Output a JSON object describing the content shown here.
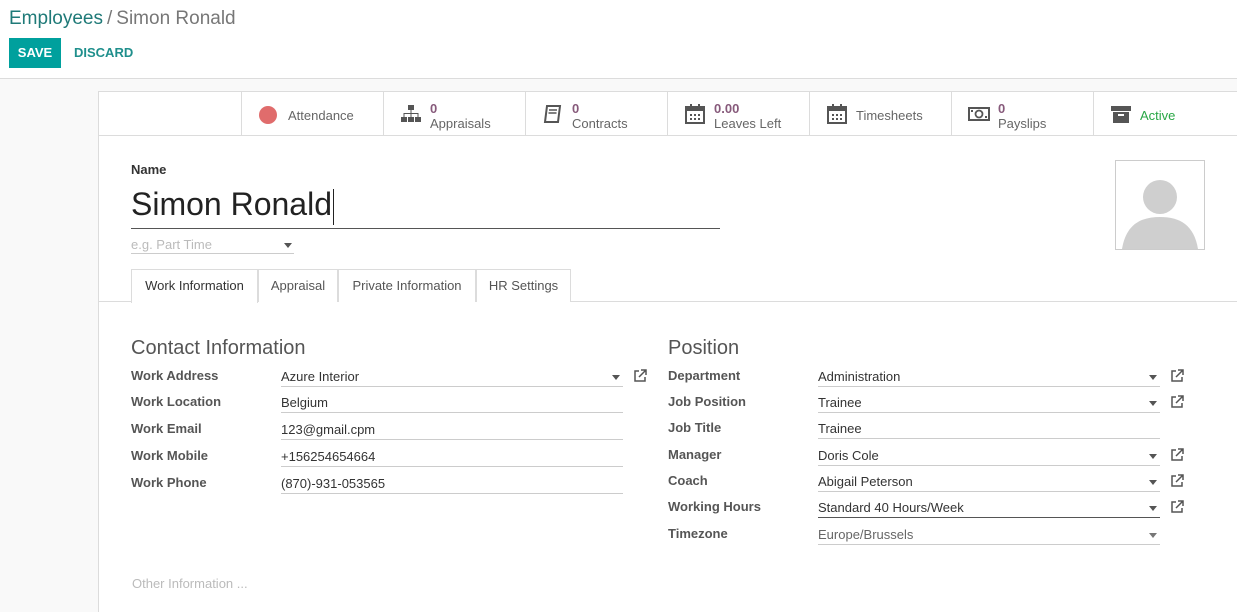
{
  "breadcrumb": {
    "parent": "Employees",
    "separator": "/",
    "current": "Simon Ronald"
  },
  "actions": {
    "save": "SAVE",
    "discard": "DISCARD"
  },
  "smart_buttons": {
    "attendance": {
      "label": "Attendance"
    },
    "appraisals": {
      "value": "0",
      "label": "Appraisals"
    },
    "contracts": {
      "value": "0",
      "label": "Contracts"
    },
    "leaves": {
      "value": "0.00",
      "label": "Leaves Left"
    },
    "timesheets": {
      "label": "Timesheets"
    },
    "payslips": {
      "value": "0",
      "label": "Payslips"
    },
    "active": {
      "label": "Active"
    }
  },
  "colors": {
    "attendance_dot": "#e06c6c",
    "active_text": "#28a745",
    "accent": "#00a09d",
    "stat_number": "#875a7b"
  },
  "form": {
    "name_label": "Name",
    "name_value": "Simon Ronald",
    "job_placeholder": "e.g. Part Time"
  },
  "tabs": [
    "Work Information",
    "Appraisal",
    "Private Information",
    "HR Settings"
  ],
  "contact": {
    "title": "Contact Information",
    "work_address": {
      "label": "Work Address",
      "value": "Azure Interior"
    },
    "work_location": {
      "label": "Work Location",
      "value": "Belgium"
    },
    "work_email": {
      "label": "Work Email",
      "value": "123@gmail.cpm"
    },
    "work_mobile": {
      "label": "Work Mobile",
      "value": "+156254654664"
    },
    "work_phone": {
      "label": "Work Phone",
      "value": "(870)-931-053565"
    }
  },
  "position": {
    "title": "Position",
    "department": {
      "label": "Department",
      "value": "Administration"
    },
    "job_position": {
      "label": "Job Position",
      "value": "Trainee"
    },
    "job_title": {
      "label": "Job Title",
      "value": "Trainee"
    },
    "manager": {
      "label": "Manager",
      "value": "Doris Cole"
    },
    "coach": {
      "label": "Coach",
      "value": "Abigail Peterson"
    },
    "working_hours": {
      "label": "Working Hours",
      "value": "Standard 40 Hours/Week"
    },
    "timezone": {
      "label": "Timezone",
      "value": "Europe/Brussels"
    }
  },
  "other_info": "Other Information ..."
}
